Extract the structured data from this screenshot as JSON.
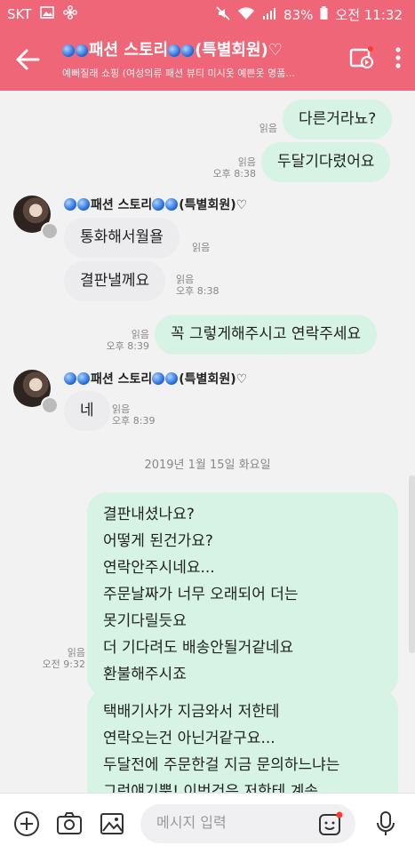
{
  "status": {
    "carrier": "SKT",
    "battery": "83%",
    "time": "오전 11:32"
  },
  "header": {
    "title": "패션 스토리",
    "title_suffix": "(특별회원)♡",
    "subtitle": "예뻐질래 쇼핑 (여성의류 패션 뷰티 미시옷 예쁜옷 명품..."
  },
  "messages": {
    "m1": {
      "text": "다른거라뇨?",
      "read": "읽음",
      "time": ""
    },
    "m2": {
      "text": "두달기다렸어요",
      "read": "읽음",
      "time": "오후 8:38"
    },
    "sender1": {
      "name": "패션 스토리",
      "suffix": "(특별회원)♡"
    },
    "m3": {
      "text": "통화해서월욜",
      "read": "읽음",
      "time": ""
    },
    "m4": {
      "text": "결판낼께요",
      "read": "읽음",
      "time": "오후 8:38"
    },
    "m5": {
      "text": "꼭 그렇게해주시고 연락주세요",
      "read": "읽음",
      "time": "오후 8:39"
    },
    "sender2": {
      "name": "패션 스토리",
      "suffix": "(특별회원)♡"
    },
    "m6": {
      "text": "네",
      "read": "읽음",
      "time": "오후 8:39"
    },
    "date_divider": "2019년 1월 15일 화요일",
    "m7": {
      "lines": [
        "결판내셨나요?",
        "어떻게 된건가요?",
        "연락안주시네요...",
        "주문날짜가 너무 오래되어 더는",
        "못기다릴듯요",
        "더 기다려도 배송안될거같네요",
        "환불해주시죠"
      ],
      "read": "읽음",
      "time": "오전 9:32"
    },
    "m8": {
      "lines": [
        "택배기사가 지금와서 저한테",
        "연락오는건 아닌거같구요...",
        "두달전에 주문한걸 지금 문의하느냐는",
        "그런얘기뿐! 이번건은 저한테 계속"
      ]
    }
  },
  "input": {
    "placeholder": "메시지 입력"
  },
  "colors": {
    "accent": "#ee6677",
    "outgoing": "#d6f3e5",
    "incoming": "#ececef"
  }
}
